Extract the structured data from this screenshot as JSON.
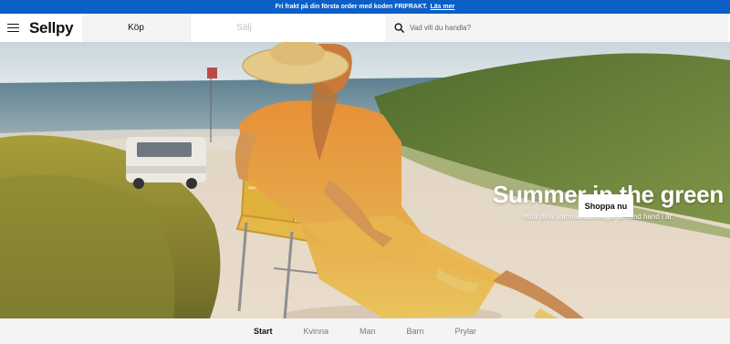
{
  "promo": {
    "text": "Fri frakt på din första order med koden FRIFRAKT.",
    "link": "Läs mer"
  },
  "header": {
    "logo": "Sellpy",
    "tabs": [
      {
        "label": "Köp",
        "active": true
      },
      {
        "label": "Sälj",
        "active": false
      }
    ],
    "search_placeholder": "Vad vill du handla?"
  },
  "hero": {
    "title": "Summer in the green",
    "subtitle": "Hitta dina sommarklänningar second hand i år.",
    "cta": "Shoppa nu"
  },
  "bottom_nav": {
    "items": [
      {
        "label": "Start",
        "active": true
      },
      {
        "label": "Kvinna",
        "active": false
      },
      {
        "label": "Man",
        "active": false
      },
      {
        "label": "Barn",
        "active": false
      },
      {
        "label": "Prylar",
        "active": false
      }
    ]
  },
  "colors": {
    "promo_bar": "#0b5fc7",
    "accent_text": "#ffffff",
    "nav_background": "#f4f4f4"
  }
}
